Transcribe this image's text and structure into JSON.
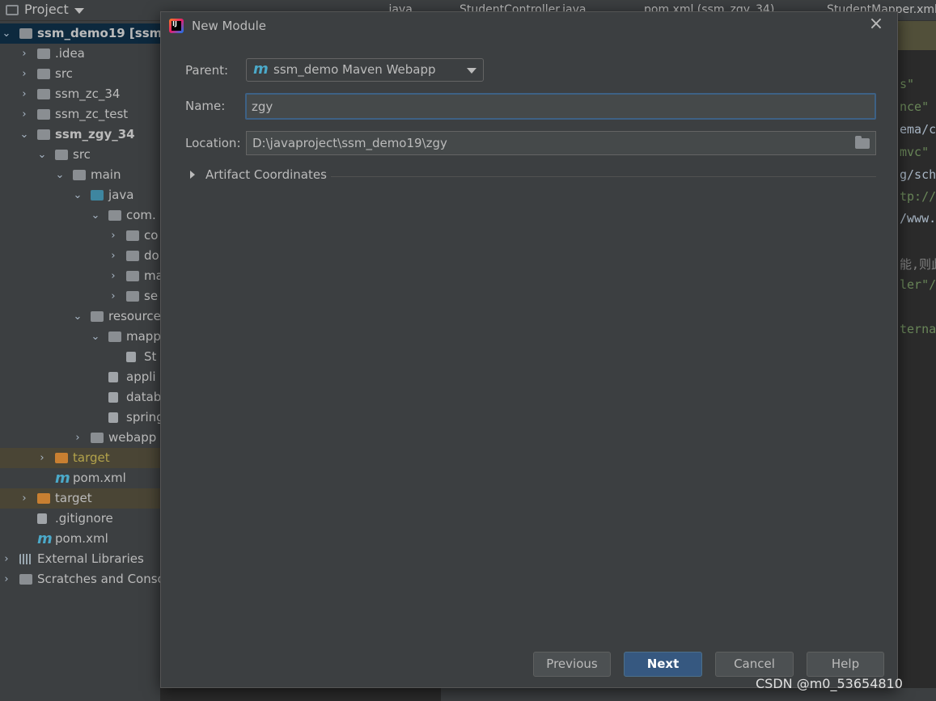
{
  "ide": {
    "project_header": "Project",
    "tabs": [
      ".java",
      "StudentController.java",
      "pom.xml (ssm_zgy_34)",
      "StudentMapper.xml"
    ],
    "tree": [
      {
        "label": "ssm_demo19 [ssm_d",
        "kind": "module"
      },
      {
        "label": ".idea",
        "kind": "folder"
      },
      {
        "label": "src",
        "kind": "folder"
      },
      {
        "label": "ssm_zc_34",
        "kind": "folder"
      },
      {
        "label": "ssm_zc_test",
        "kind": "folder"
      },
      {
        "label": "ssm_zgy_34",
        "kind": "module"
      },
      {
        "label": "src",
        "kind": "folder"
      },
      {
        "label": "main",
        "kind": "folder"
      },
      {
        "label": "java",
        "kind": "folder-blue"
      },
      {
        "label": "com.",
        "kind": "package"
      },
      {
        "label": "co",
        "kind": "package"
      },
      {
        "label": "do",
        "kind": "package"
      },
      {
        "label": "ma",
        "kind": "package"
      },
      {
        "label": "se",
        "kind": "package"
      },
      {
        "label": "resource",
        "kind": "folder"
      },
      {
        "label": "mapp",
        "kind": "folder"
      },
      {
        "label": "St",
        "kind": "file"
      },
      {
        "label": "appli",
        "kind": "file"
      },
      {
        "label": "datab",
        "kind": "file"
      },
      {
        "label": "spring",
        "kind": "file"
      },
      {
        "label": "webapp",
        "kind": "folder"
      },
      {
        "label": "target",
        "kind": "folder-orange"
      },
      {
        "label": "pom.xml",
        "kind": "maven"
      },
      {
        "label": "target",
        "kind": "folder-orange"
      },
      {
        "label": ".gitignore",
        "kind": "file"
      },
      {
        "label": "pom.xml",
        "kind": "maven"
      },
      {
        "label": "External Libraries",
        "kind": "lib"
      },
      {
        "label": "Scratches and Conso",
        "kind": "scratch"
      }
    ],
    "code_lines": [
      "s\"",
      "nce\"",
      "ema/c",
      "mvc\"",
      "g/sch",
      "tp://",
      "/www.",
      "能,则此",
      "ler\"/",
      "terna"
    ]
  },
  "dialog": {
    "title": "New Module",
    "parent_label": "Parent:",
    "parent_value": "ssm_demo Maven Webapp",
    "name_label": "Name:",
    "name_value": "zgy",
    "location_label": "Location:",
    "location_value": "D:\\javaproject\\ssm_demo19\\zgy",
    "artifact_label": "Artifact Coordinates",
    "buttons": {
      "previous": "Previous",
      "next": "Next",
      "cancel": "Cancel",
      "help": "Help"
    }
  },
  "watermark": "CSDN @m0_53654810",
  "colors": {
    "dialog_bg": "#3c3f41",
    "primary_button": "#365880",
    "focus_border": "#3d6185"
  }
}
